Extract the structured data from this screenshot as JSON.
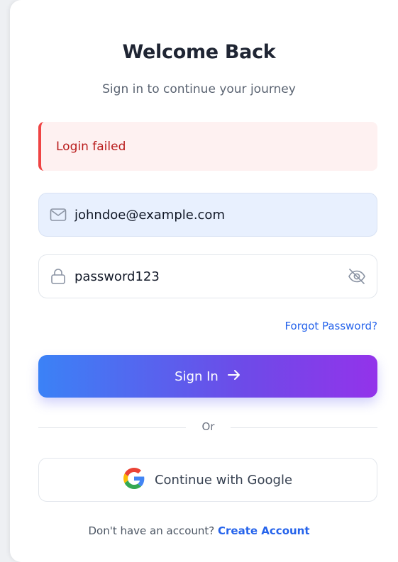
{
  "header": {
    "title": "Welcome Back",
    "subtitle": "Sign in to continue your journey"
  },
  "alert": {
    "message": "Login failed",
    "color": "#ef4444"
  },
  "form": {
    "email": {
      "value": "johndoe@example.com",
      "icon": "mail-icon"
    },
    "password": {
      "value": "password123",
      "icon": "lock-icon",
      "toggle_icon": "eye-off-icon"
    },
    "forgot_label": "Forgot Password?",
    "submit_label": "Sign In",
    "submit_icon": "arrow-right-icon"
  },
  "divider": {
    "label": "Or"
  },
  "social": {
    "google_label": "Continue with Google",
    "icon": "google-icon"
  },
  "footer": {
    "prompt": "Don't have an account?",
    "link_label": "Create Account"
  },
  "colors": {
    "accent": "#2563eb",
    "gradient_start": "#3b82f6",
    "gradient_end": "#9333ea"
  }
}
